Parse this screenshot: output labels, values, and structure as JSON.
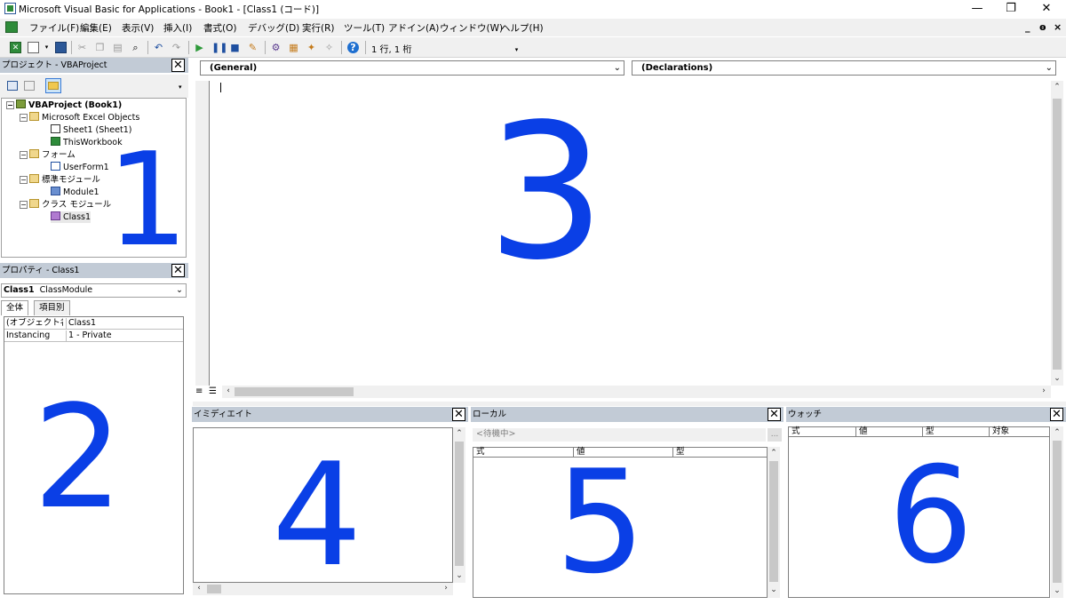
{
  "window": {
    "title": "Microsoft Visual Basic for Applications - Book1 - [Class1 (コード)]",
    "minimize": "—",
    "restore": "❐",
    "close": "✕"
  },
  "menu": {
    "items": [
      "ファイル(F)",
      "編集(E)",
      "表示(V)",
      "挿入(I)",
      "書式(O)",
      "デバッグ(D)",
      "実行(R)",
      "ツール(T)",
      "アドイン(A)",
      "ウィンドウ(W)",
      "ヘルプ(H)"
    ],
    "mdi_min": "_",
    "mdi_restore": "ɵ",
    "mdi_close": "×"
  },
  "toolbar": {
    "position_text": "1 行, 1 桁"
  },
  "project": {
    "title": "プロジェクト - VBAProject",
    "root": "VBAProject (Book1)",
    "excel_objects": "Microsoft Excel Objects",
    "sheet1": "Sheet1 (Sheet1)",
    "thisworkbook": "ThisWorkbook",
    "forms_folder": "フォーム",
    "userform1": "UserForm1",
    "modules_folder": "標準モジュール",
    "module1": "Module1",
    "class_folder": "クラス モジュール",
    "class1": "Class1"
  },
  "properties": {
    "title": "プロパティ - Class1",
    "combo_name": "Class1",
    "combo_type": "ClassModule",
    "tab_all": "全体",
    "tab_category": "項目別",
    "rows": [
      {
        "name": "(オブジェクト名)",
        "value": "Class1"
      },
      {
        "name": "Instancing",
        "value": "1 - Private"
      }
    ]
  },
  "code": {
    "object_combo": "(General)",
    "proc_combo": "(Declarations)"
  },
  "immediate": {
    "title": "イミディエイト"
  },
  "locals": {
    "title": "ローカル",
    "status": "<待機中>",
    "ellipsis": "...",
    "columns": [
      "式",
      "値",
      "型"
    ]
  },
  "watch": {
    "title": "ウォッチ",
    "columns": [
      "式",
      "値",
      "型",
      "対象"
    ]
  },
  "annotations": [
    "1",
    "2",
    "3",
    "4",
    "5",
    "6"
  ],
  "colors": {
    "panel_title": "#c2cbd6",
    "annotation_blue": "#0a3fe6"
  }
}
